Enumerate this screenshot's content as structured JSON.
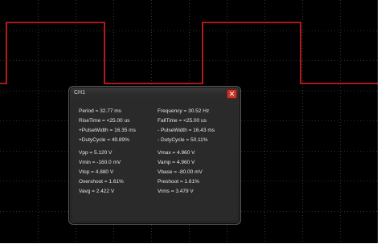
{
  "dialog": {
    "title": "CH1"
  },
  "colors": {
    "trace": "#e02020",
    "grid": "#5a5a5a",
    "background": "#000000"
  },
  "measurements": {
    "period": "Period = 32.77 ms",
    "frequency": "Frequency = 30.52 Hz",
    "rise_time": "RiseTime = <25.00 us",
    "fall_time": "FallTime = <25.00 us",
    "pos_pulse_width": "+PulseWidth = 16.35 ms",
    "neg_pulse_width": "- PulseWidth = 16.43 ms",
    "pos_duty_cycle": "+DutyCycle = 49.89%",
    "neg_duty_cycle": "- DutyCycle = 50.11%",
    "vpp": "Vpp = 5.120 V",
    "vmax": "Vmax = 4.960 V",
    "vmin": "Vmin = -160.0 mV",
    "vamp": "Vamp = 4.960 V",
    "vtop": "Vtop = 4.880 V",
    "vbase": "Vbase = -80.00 mV",
    "overshoot": "Overshoot = 1.61%",
    "preshoot": "Preshoot = 1.61%",
    "vavg": "Vavg = 2.422 V",
    "vrms": "Vrms = 3.479 V"
  }
}
